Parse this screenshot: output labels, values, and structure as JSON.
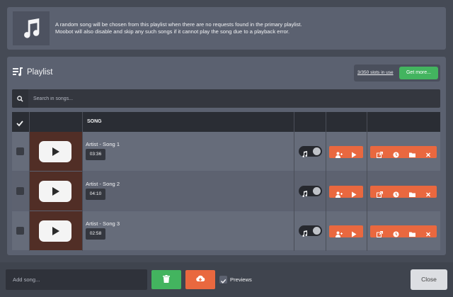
{
  "info": {
    "line1": "A random song will be chosen from this playlist when there are no requests found in the primary playlist.",
    "line2": "Moobot will also disable and skip any such songs if it cannot play the song due to a playback error."
  },
  "playlist": {
    "title": "Playlist",
    "slots_text": "3/350 slots in use",
    "get_more_label": "Get more..."
  },
  "search": {
    "placeholder": "Search in songs..."
  },
  "table": {
    "song_header": "SONG",
    "rows": [
      {
        "title": "Artist - Song 1",
        "duration": "03:36"
      },
      {
        "title": "Artist - Song 2",
        "duration": "04:10"
      },
      {
        "title": "Artist - Song 3",
        "duration": "02:58"
      }
    ]
  },
  "footer": {
    "add_placeholder": "Add song...",
    "previews_label": "Previews",
    "previews_checked": true,
    "close_label": "Close"
  },
  "colors": {
    "accent_green": "#43b45f",
    "accent_orange": "#e9683f",
    "thumbnail_bg": "#512e26"
  },
  "icons": {
    "info": "music-note-icon",
    "playlist": "playlist-icon",
    "search": "search-icon",
    "header_check": "check-icon",
    "row_thumbnail": "youtube-play-icon",
    "row_toggle": "music-note-icon",
    "row_actions_a": [
      "add-user-icon",
      "play-icon"
    ],
    "row_actions_b": [
      "external-link-icon",
      "clock-icon",
      "folder-icon",
      "close-icon"
    ],
    "footer_delete": "trash-icon",
    "footer_download": "cloud-download-icon"
  }
}
